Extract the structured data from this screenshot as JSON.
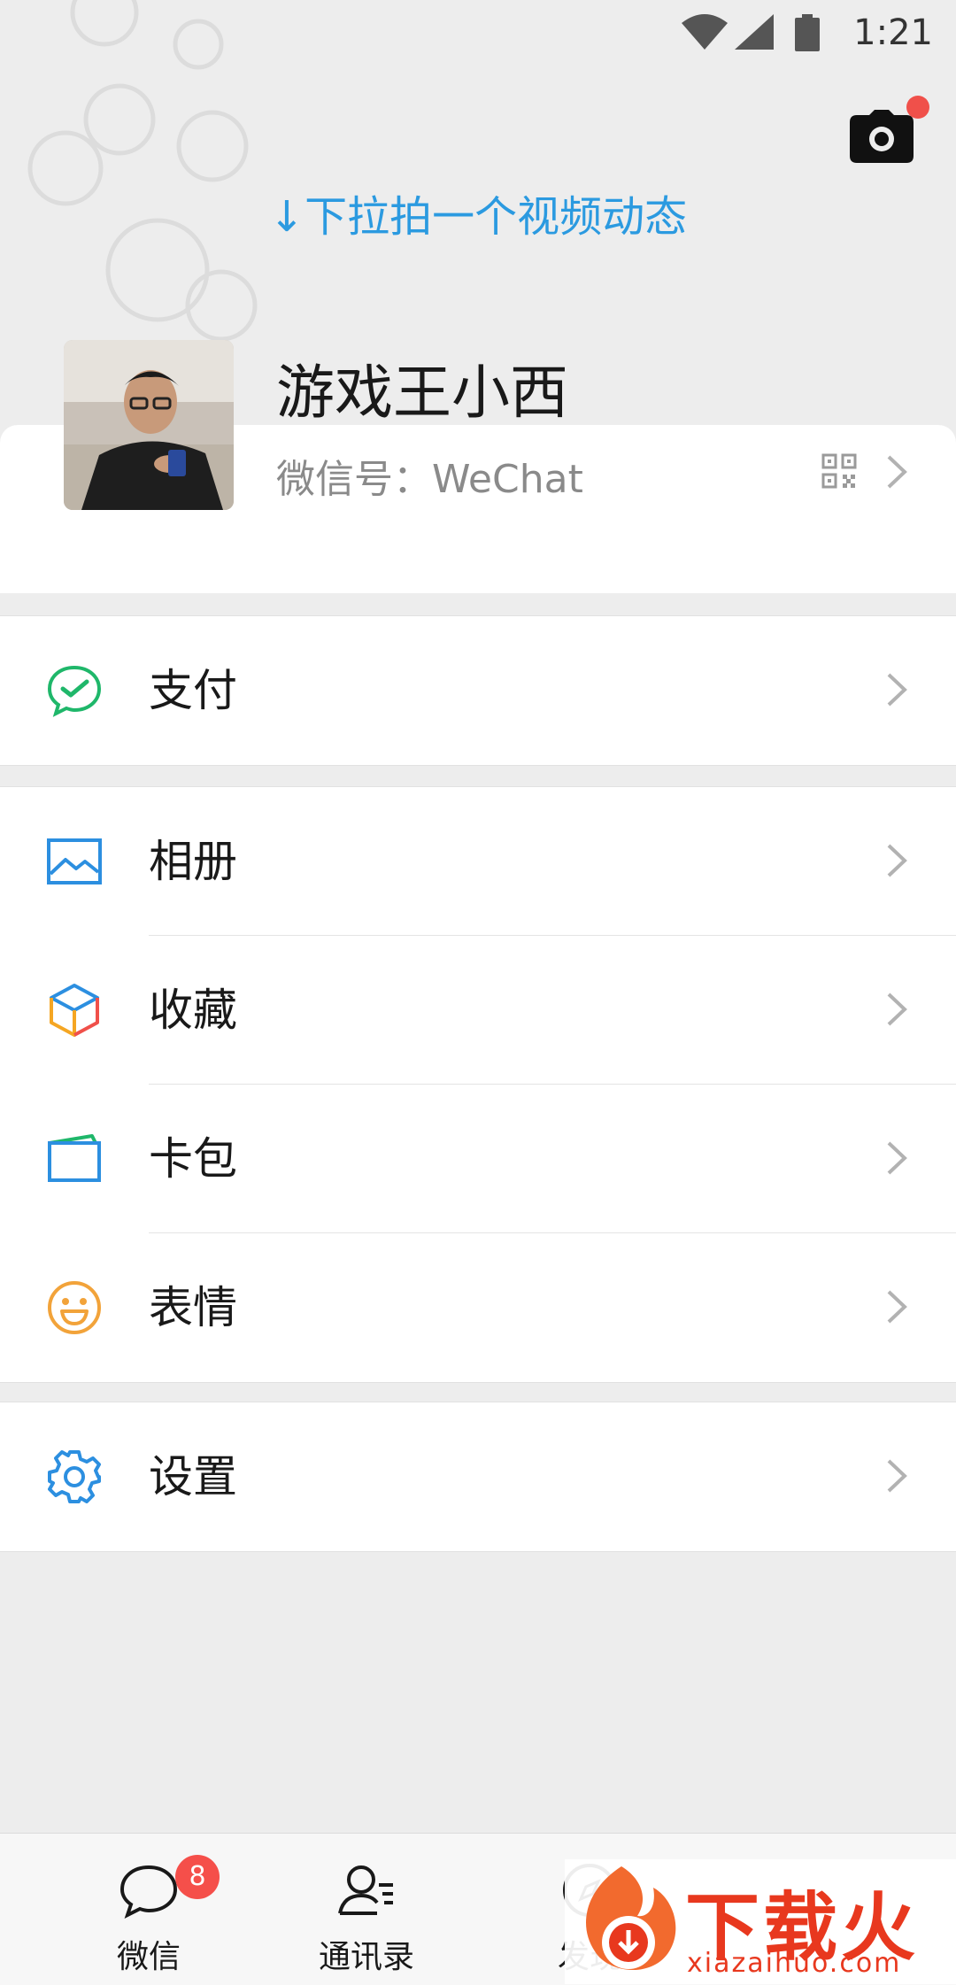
{
  "status_bar": {
    "time": "1:21"
  },
  "pull_hint": "↓下拉拍一个视频动态",
  "profile": {
    "nickname": "游戏王小西",
    "wechat_id": "微信号：WeChat"
  },
  "menu": {
    "pay": "支付",
    "album": "相册",
    "favorites": "收藏",
    "cards": "卡包",
    "stickers": "表情",
    "settings": "设置"
  },
  "tabs": {
    "chats": "微信",
    "chats_badge": "8",
    "contacts": "通讯录",
    "discover": "发现"
  },
  "watermark": {
    "brand": "下载火",
    "url": "xiazaihuo.com"
  },
  "colors": {
    "accent_blue": "#2b9ae0",
    "pay_green": "#1fb76a",
    "badge_red": "#f54f4a",
    "sticker_orange": "#f2a33a"
  }
}
